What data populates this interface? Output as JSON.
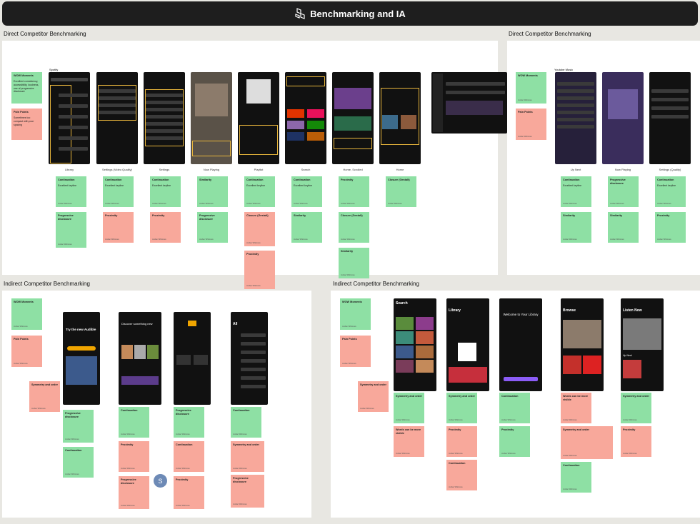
{
  "header": {
    "title": "Benchmarking and IA",
    "icon": "component-icon"
  },
  "sections": {
    "direct": "Direct Competitor Benchmarking",
    "direct2": "Direct Competitor Benchmarking",
    "indirect": "Indirect Competitor Benchmarking",
    "indirect2": "Indirect Competitor Benchmarking"
  },
  "spotify_label": "Spotify",
  "youtube_label": "Youtube Music",
  "captions": [
    "Library",
    "Settings (Video Quality)",
    "Settings",
    "Now Playing",
    "Playlist",
    "Search",
    "Home, Scrolled",
    "Home",
    "Up Next",
    "Now Playing",
    "Settings (Quality)"
  ],
  "common": {
    "wow": "WOW Moments",
    "pain": "Pain Points",
    "wow_text": "Excellent consistency, accessibility, loudness, use of progressive disclosure",
    "pain_text": "Sometimes too compact with poor spacing",
    "author": "Jordan Whitmore",
    "continuation": "Continuation",
    "excellent": "Excellent keyline",
    "proximity": "Proximity",
    "similarity": "Similarity",
    "progressive": "Progressive disclosure",
    "closure": "Closure (Gestalt)",
    "symmetry": "Symmetry and order",
    "words": "Words can be more visible"
  },
  "audible": {
    "promo": "Try the new Audible",
    "discover": "Discover something new",
    "all": "All"
  },
  "podcasts": {
    "search": "Search",
    "library": "Library",
    "welcome": "Welcome to Your Library",
    "browse": "Browse",
    "listen": "Listen Now",
    "up_next": "Up Next"
  },
  "avatar_initial": "S"
}
